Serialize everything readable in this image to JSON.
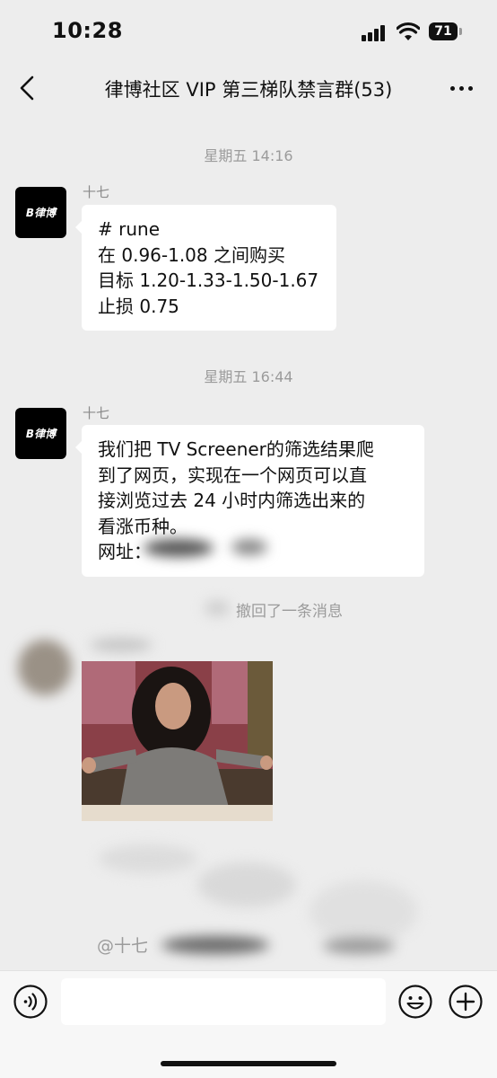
{
  "status_bar": {
    "time": "10:28",
    "battery": "71",
    "icons": [
      "signal-icon",
      "wifi-icon",
      "battery-icon"
    ]
  },
  "nav": {
    "title": "律博社区 VIP 第三梯队禁言群(53)",
    "icons": [
      "back-icon",
      "more-icon"
    ]
  },
  "messages": [
    {
      "timestamp": "星期五 14:16",
      "sender": "十七",
      "avatar_text": "B律博",
      "lines": [
        "# rune",
        "在 0.96-1.08 之间购买",
        "目标 1.20-1.33-1.50-1.67",
        "止损 0.75"
      ]
    },
    {
      "timestamp": "星期五 16:44",
      "sender": "十七",
      "avatar_text": "B律博",
      "lines": [
        "我们把 TV Screener的筛选结果爬",
        "到了网页，实现在一个网页可以直",
        "接浏览过去 24 小时内筛选出来的",
        "看涨币种。",
        "网址："
      ]
    }
  ],
  "recall_notice": "撤回了一条消息",
  "mention_text": "@十七",
  "input_bar": {
    "placeholder": "",
    "icons": [
      "voice-icon",
      "emoji-icon",
      "plus-icon"
    ]
  },
  "colors": {
    "background": "#ededed",
    "bubble": "#ffffff",
    "meta_text": "#9b9b9b",
    "avatar": "#000000"
  }
}
